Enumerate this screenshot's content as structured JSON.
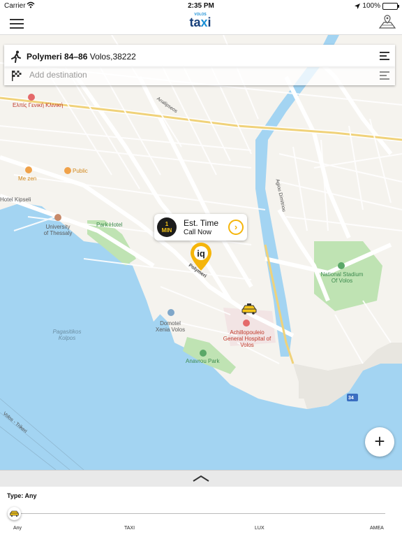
{
  "status_bar": {
    "carrier": "Carrier",
    "time": "2:35 PM",
    "battery": "100%"
  },
  "navbar": {
    "logo_small": "VOLOS",
    "logo_main_1": "ta",
    "logo_main_x": "x",
    "logo_main_2": "i"
  },
  "pickup": {
    "street": "Polymeri 84–86",
    "city": "Volos,38222"
  },
  "destination": {
    "placeholder": "Add destination"
  },
  "eta": {
    "value": "1",
    "unit": "MIN",
    "title": "Est. Time",
    "subtitle": "Call Now"
  },
  "map_labels": {
    "hospital_top": "Ελπίς Γενική Κλινική",
    "me_zen": "Me zen",
    "public": "Public",
    "hotel_kipseli": "Hotel Kipseli",
    "university": "University of Thessaly",
    "park_hotel": "Park Hotel",
    "domotel": "Domotel Xenia Volos",
    "hospital": "Achillopouleio General Hospital of Volos",
    "anavrou_park": "Anavrou Park",
    "stadium": "National Stadium Of Volos",
    "gulf": "Pagasitikos Kolpos",
    "road_badge": "34",
    "polymeri": "Polymeri",
    "anaipseos": "Analipseos",
    "agiou_dimitriou": "Agiou Dimitriou",
    "volos_trikeri": "Volos - Trikeri"
  },
  "panel": {
    "type_label": "Type: Any",
    "ticks": [
      "Any",
      "TAXI",
      "LUX",
      "AMEA"
    ]
  },
  "colors": {
    "accent": "#f5b50a",
    "water": "#a3d4f2",
    "park": "#bfe3b3",
    "road": "#ffffff"
  }
}
